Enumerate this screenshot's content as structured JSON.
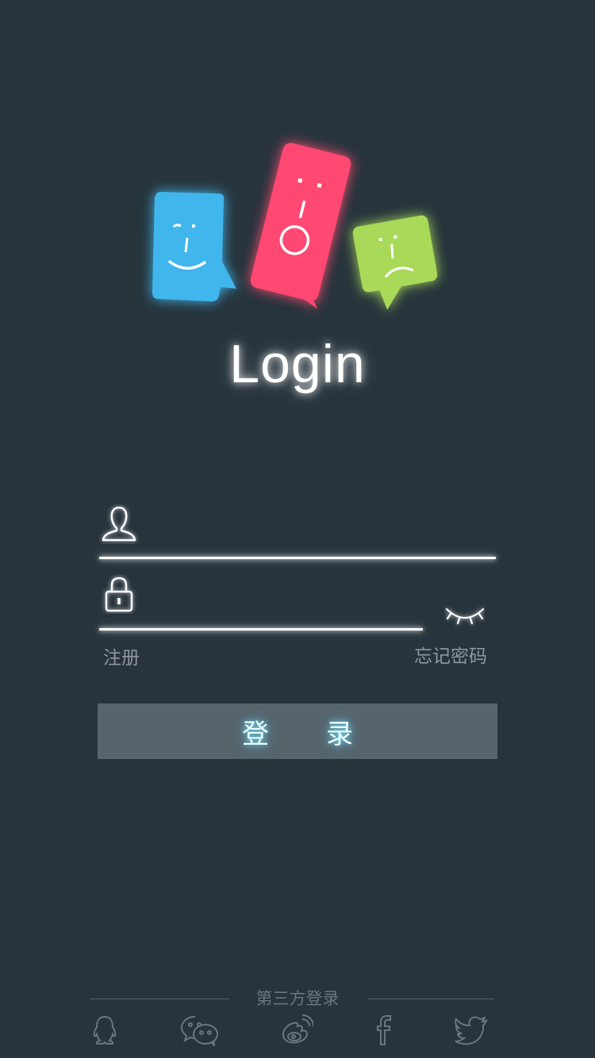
{
  "app": {
    "title": "Login"
  },
  "form": {
    "username": {
      "placeholder": "",
      "value": ""
    },
    "password": {
      "placeholder": "",
      "value": ""
    },
    "register_label": "注册",
    "forgot_label": "忘记密码",
    "login_label": "登录"
  },
  "third_party": {
    "title": "第三方登录",
    "providers": [
      {
        "name": "qq",
        "icon": "qq-icon"
      },
      {
        "name": "wechat",
        "icon": "wechat-icon"
      },
      {
        "name": "weibo",
        "icon": "weibo-icon"
      },
      {
        "name": "facebook",
        "icon": "facebook-icon"
      },
      {
        "name": "twitter",
        "icon": "twitter-icon"
      }
    ]
  },
  "colors": {
    "background": "#27343c",
    "blue": "#3fb6ec",
    "pink": "#ff4a72",
    "green": "#a8d958",
    "button": "#57646c"
  }
}
